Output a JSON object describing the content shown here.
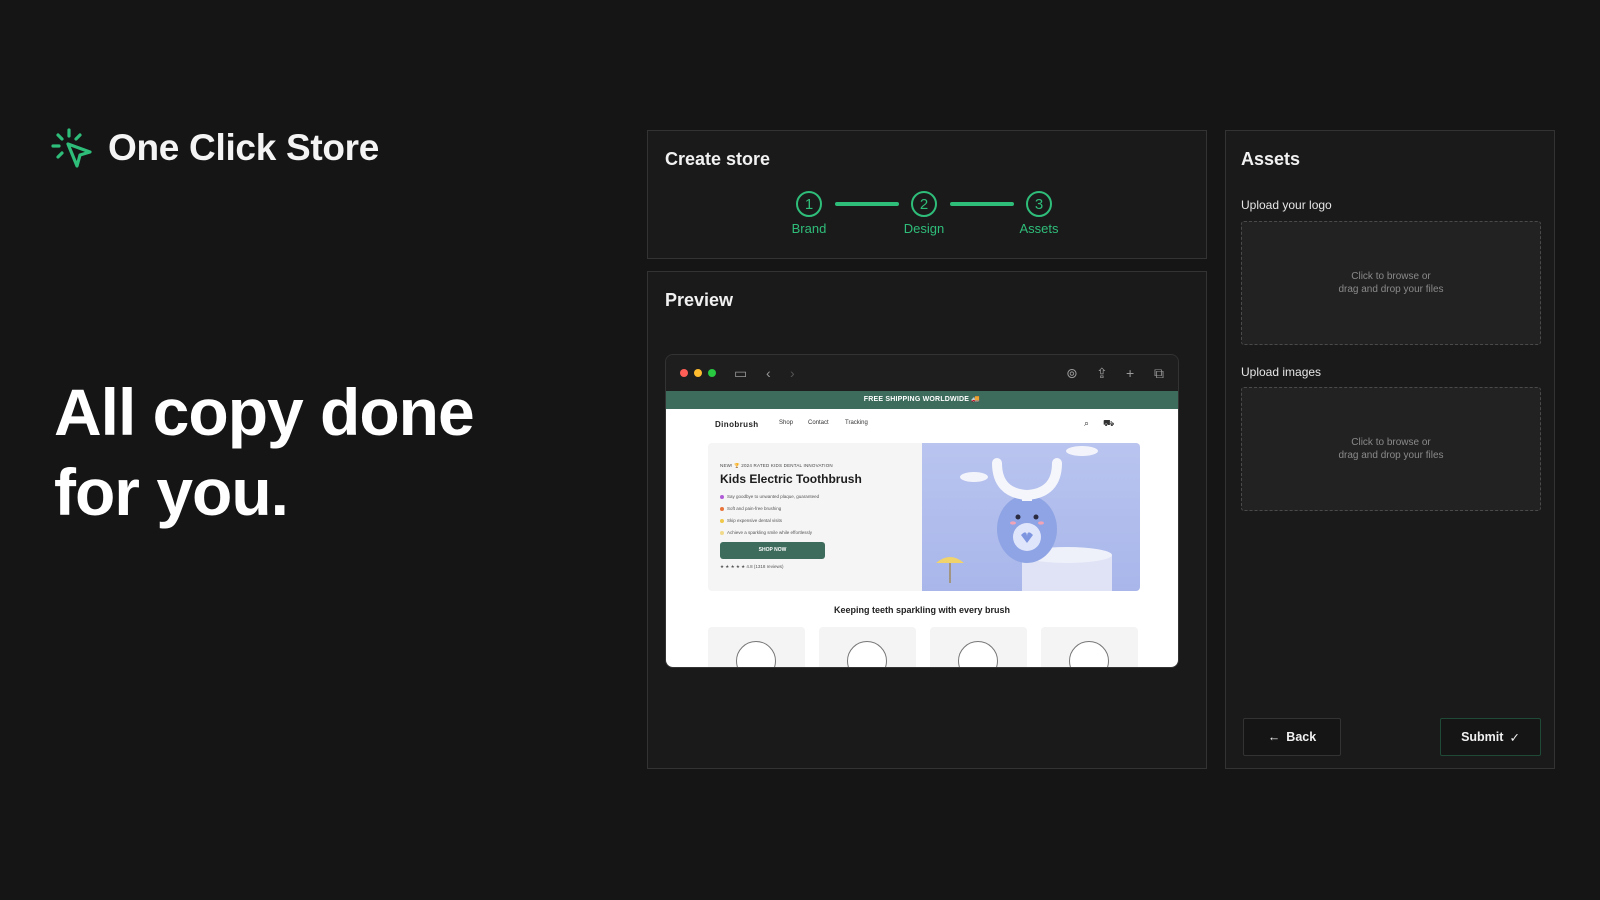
{
  "brand": {
    "name": "One Click Store",
    "logo_icon": "cursor-sparkle-icon",
    "accent": "#2fbd7a"
  },
  "headline": {
    "line1": "All copy done",
    "line2": "for you."
  },
  "create_store": {
    "title": "Create store",
    "steps": [
      {
        "number": "1",
        "label": "Brand"
      },
      {
        "number": "2",
        "label": "Design"
      },
      {
        "number": "3",
        "label": "Assets"
      }
    ]
  },
  "preview": {
    "title": "Preview",
    "browser": {
      "banner": "FREE SHIPPING WORLDWIDE 🚚",
      "site_name": "Dinobrush",
      "nav": [
        "Shop",
        "Contact",
        "Tracking"
      ],
      "hero": {
        "kicker": "NEW! 🏆 2024 RATED KIDS DENTAL INNOVATION",
        "title": "Kids Electric Toothbrush",
        "bullets": [
          "Say goodbye to unwanted plaque, guaranteed",
          "Soft and pain-free brushing",
          "Skip expensive dental visits",
          "Achieve a sparkling smile while effortlessly"
        ],
        "cta": "SHOP NOW",
        "rating": "★ ★ ★ ★ ★  4.8 (1318 reviews)"
      },
      "section_title": "Keeping teeth sparkling with every brush"
    }
  },
  "assets": {
    "title": "Assets",
    "logo_label": "Upload your logo",
    "images_label": "Upload images",
    "dropzone_line1": "Click to browse or",
    "dropzone_line2": "drag and drop your files",
    "back_label": "Back",
    "submit_label": "Submit"
  }
}
